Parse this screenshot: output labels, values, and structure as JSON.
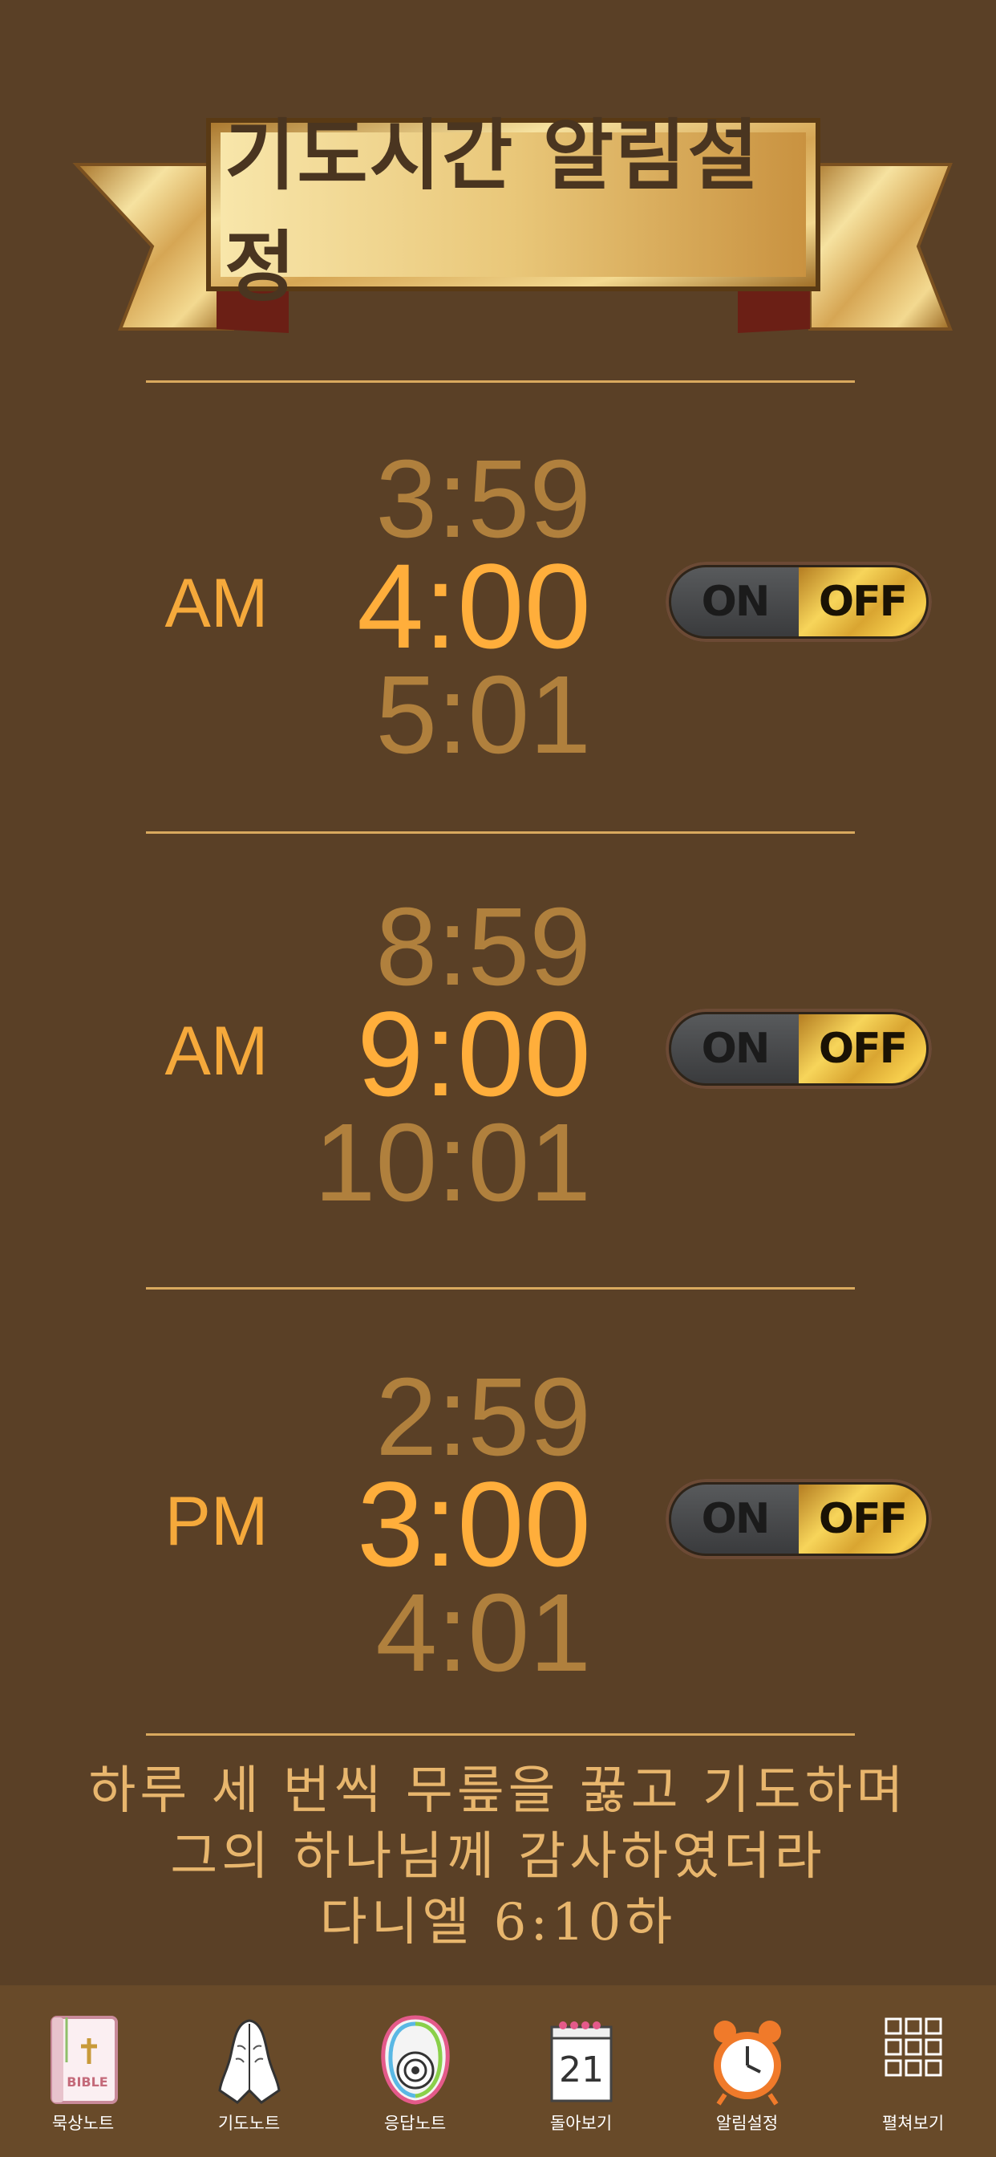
{
  "header": {
    "title": "기도시간 알림설정"
  },
  "alarms": [
    {
      "period": "AM",
      "prev": "3:59",
      "current": "4:00",
      "next": "5:01",
      "toggle": {
        "on": "ON",
        "off": "OFF"
      }
    },
    {
      "period": "AM",
      "prev": "8:59",
      "current": "9:00",
      "next": "10:01",
      "toggle": {
        "on": "ON",
        "off": "OFF"
      }
    },
    {
      "period": "PM",
      "prev": "2:59",
      "current": "3:00",
      "next": "4:01",
      "toggle": {
        "on": "ON",
        "off": "OFF"
      }
    }
  ],
  "verse": {
    "line1": "하루 세 번씩 무릎을 꿇고 기도하며",
    "line2": "그의 하나님께 감사하였더라",
    "line3": "다니엘 6:10하"
  },
  "nav": [
    {
      "label": "묵상노트",
      "icon": "bible-icon"
    },
    {
      "label": "기도노트",
      "icon": "praying-hands-icon"
    },
    {
      "label": "응답노트",
      "icon": "target-icon"
    },
    {
      "label": "돌아보기",
      "icon": "calendar-icon",
      "icon_text": "21"
    },
    {
      "label": "알림설정",
      "icon": "alarm-clock-icon"
    },
    {
      "label": "펼쳐보기",
      "icon": "grid-icon"
    }
  ],
  "colors": {
    "background": "#5a4026",
    "accent": "#ffae3b",
    "dim": "#b0803d",
    "nav_bg": "#684a29"
  }
}
